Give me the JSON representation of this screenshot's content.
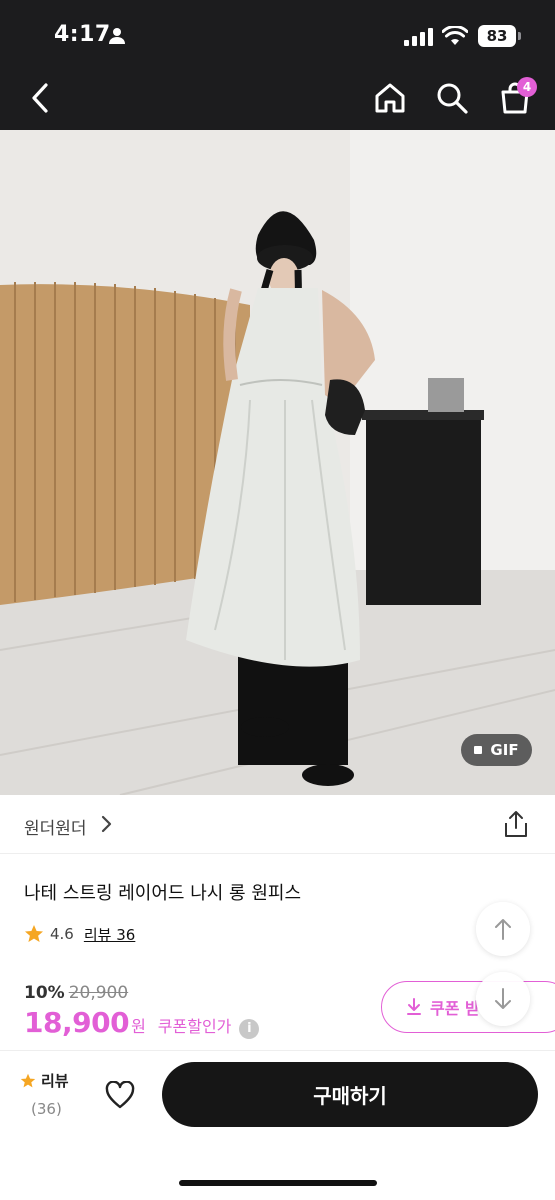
{
  "status_bar": {
    "time": "4:17",
    "battery": "83"
  },
  "header": {
    "cart_count": "4",
    "icons": [
      "back-icon",
      "home-icon",
      "search-icon",
      "cart-icon"
    ]
  },
  "media": {
    "gif_label": "GIF"
  },
  "brand": {
    "name": "원더원더"
  },
  "product": {
    "title": "나테 스트링 레이어드 나시 롱 원피스",
    "rating": "4.6",
    "review_link": "리뷰 36",
    "discount_rate": "10%",
    "original_price": "20,900",
    "price": "18,900",
    "price_unit": "원",
    "coupon_text": "쿠폰할인가",
    "coupon_button": "쿠폰 받"
  },
  "bottom_bar": {
    "review_label": "리뷰",
    "review_count": "(36)",
    "buy_label": "구매하기"
  },
  "colors": {
    "accent": "#e25fd6",
    "star": "#f5a623",
    "header_bg": "#1c1c1e",
    "buy_button": "#161616"
  }
}
